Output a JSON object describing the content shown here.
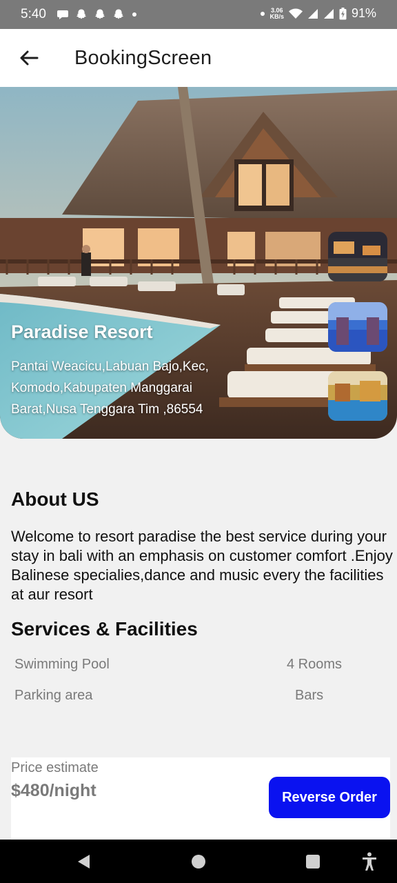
{
  "status_bar": {
    "time": "5:40",
    "net_speed_value": "3.06",
    "net_speed_unit": "KB/s",
    "battery": "91%"
  },
  "app_bar": {
    "title": "BookingScreen"
  },
  "hero": {
    "title": "Paradise Resort",
    "address": "Pantai Weacicu,Labuan Bajo,Kec, Komodo,Kabupaten Manggarai Barat,Nusa Tenggara Tim ,86554"
  },
  "about": {
    "heading": "About US",
    "text": "Welcome to resort paradise the best service during your stay in bali with an emphasis on customer comfort .Enjoy Balinese specialies,dance and music every the facilities at aur resort"
  },
  "services": {
    "heading": "Services & Facilities",
    "items": [
      "Swimming Pool",
      "4 Rooms",
      "Parking area",
      "Bars"
    ]
  },
  "price": {
    "label": "Price estimate",
    "value": "$480/night",
    "button_label": "Reverse Order"
  },
  "colors": {
    "accent": "#0a12f0",
    "muted_text": "#7a7a7a",
    "status_bar": "#7a7a7a"
  }
}
